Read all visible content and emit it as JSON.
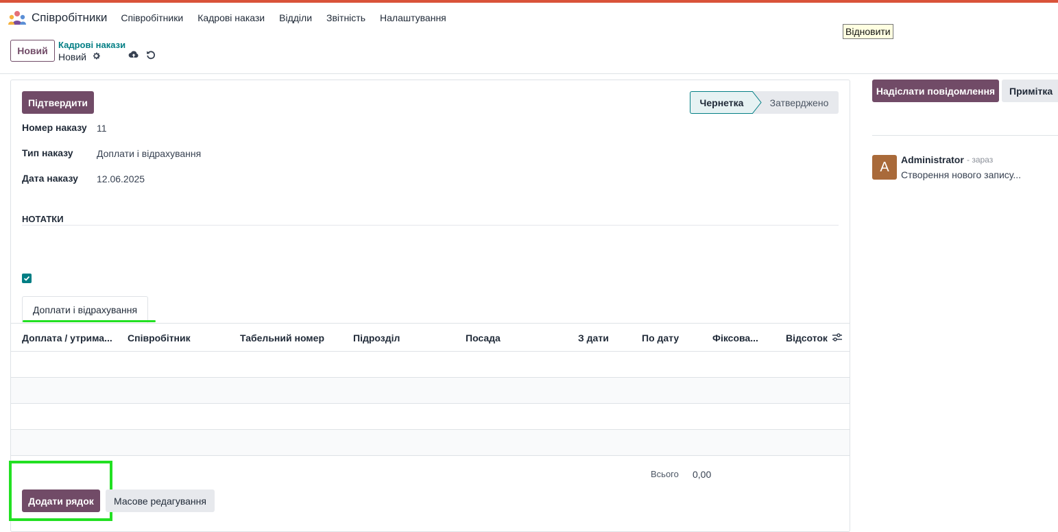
{
  "navbar": {
    "brand": "Співробітники",
    "menu": [
      "Співробітники",
      "Кадрові накази",
      "Відділи",
      "Звітність",
      "Налаштування"
    ]
  },
  "tooltip": "Відновити",
  "control": {
    "new_label": "Новий",
    "breadcrumb_parent": "Кадрові накази",
    "breadcrumb_current": "Новий"
  },
  "form": {
    "confirm_label": "Підтвердити",
    "status": {
      "draft": "Чернетка",
      "approved": "Затверджено",
      "active": "draft"
    },
    "fields": [
      {
        "label": "Номер наказу",
        "value": "11"
      },
      {
        "label": "Тип наказу",
        "value": "Доплати і відрахування"
      },
      {
        "label": "Дата наказу",
        "value": "12.06.2025"
      }
    ],
    "notes_title": "НОТАТКИ",
    "checkbox_checked": true,
    "tab_label": "Доплати і відрахування",
    "table": {
      "headers": [
        "Доплата / утрима...",
        "Співробітник",
        "Табельний номер",
        "Підрозділ",
        "Посада",
        "З дати",
        "По дату",
        "Фіксова...",
        "Відсоток"
      ],
      "rows": [],
      "total_label": "Всього",
      "total_value": "0,00"
    },
    "add_row_label": "Додати рядок",
    "mass_edit_label": "Масове редагування"
  },
  "chatter": {
    "send_label": "Надіслати повідомлення",
    "note_label": "Примітка",
    "messages": [
      {
        "avatar_letter": "A",
        "author": "Administrator",
        "time": "- зараз",
        "body": "Створення нового запису..."
      }
    ]
  },
  "colors": {
    "primary": "#714b67",
    "accent": "#017e84",
    "highlight": "#22e022",
    "topbar": "#d9533a"
  }
}
